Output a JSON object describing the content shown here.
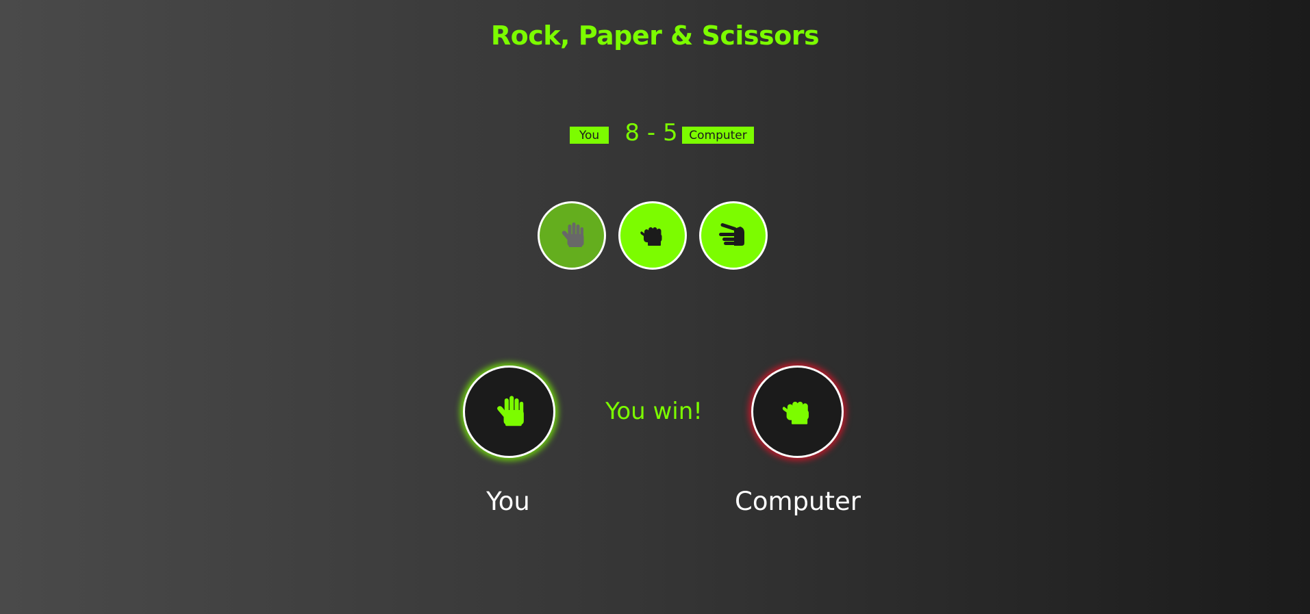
{
  "title": "Rock, Paper & Scissors",
  "scoreboard": {
    "player_label": "You",
    "score": "8 - 5",
    "computer_label": "Computer"
  },
  "choices": [
    {
      "name": "paper",
      "icon": "paper-hand-icon",
      "selected": true
    },
    {
      "name": "rock",
      "icon": "rock-fist-icon",
      "selected": false
    },
    {
      "name": "scissors",
      "icon": "scissors-hand-icon",
      "selected": false
    }
  ],
  "result": {
    "player_choice_icon": "paper-hand-icon",
    "computer_choice_icon": "rock-fist-icon",
    "outcome": "You win!",
    "player_label": "You",
    "computer_label": "Computer"
  },
  "colors": {
    "accent": "#7cfc00",
    "selected_choice": "#64ae1e",
    "dark": "#1b1b1b",
    "win_glow": "#7cfc00",
    "lose_glow": "#dc1428"
  }
}
